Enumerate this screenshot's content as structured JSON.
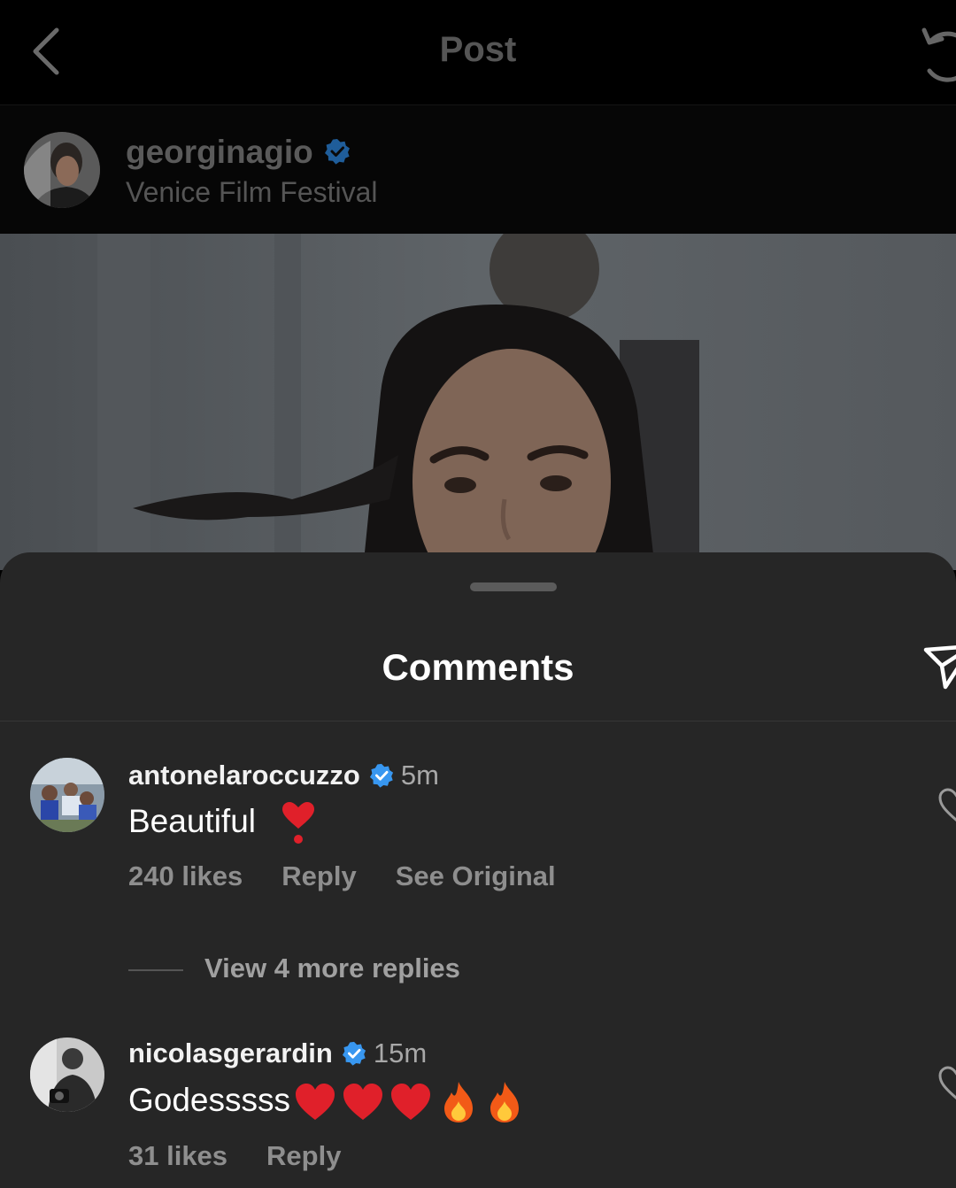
{
  "nav": {
    "title": "Post"
  },
  "post": {
    "username": "georginagio",
    "location": "Venice Film Festival"
  },
  "sheet": {
    "title": "Comments"
  },
  "comments": [
    {
      "username": "antonelaroccuzzo",
      "time": "5m",
      "text": "Beautiful",
      "likes": "240 likes",
      "reply": "Reply",
      "see_original": "See Original",
      "view_replies": "View 4 more replies"
    },
    {
      "username": "nicolasgerardin",
      "time": "15m",
      "text": "Godesssss",
      "likes": "31 likes",
      "reply": "Reply"
    }
  ],
  "icons": [
    "back-chevron-icon",
    "refresh-icon",
    "verified-badge-icon",
    "share-icon",
    "heart-outline-icon"
  ],
  "colors": {
    "verified": "#3897f0",
    "sheet_bg": "#262626"
  }
}
